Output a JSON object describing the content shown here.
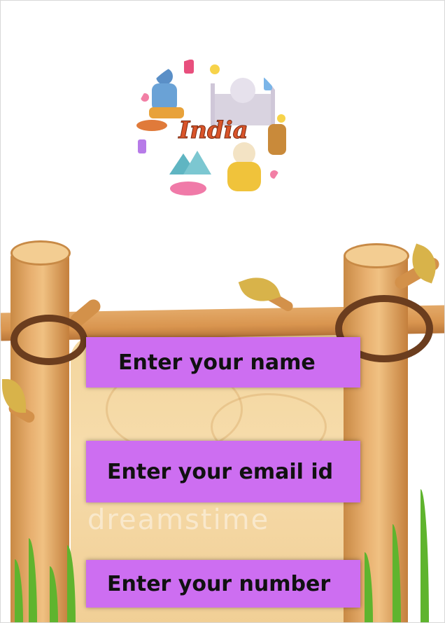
{
  "logo": {
    "text": "India"
  },
  "form": {
    "name_label": "Enter your name",
    "email_label": "Enter your email id",
    "number_label": "Enter your number"
  },
  "watermark": "dreamstime",
  "colors": {
    "field": "#cd6ef1",
    "wood": "#d9954f",
    "board": "#f3d59d"
  }
}
